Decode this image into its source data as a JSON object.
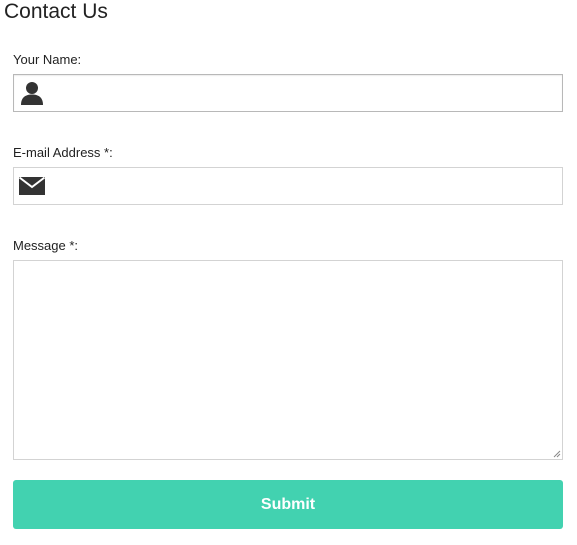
{
  "page": {
    "title": "Contact Us"
  },
  "form": {
    "name": {
      "label": "Your Name:",
      "value": "",
      "placeholder": "",
      "icon": "user-icon"
    },
    "email": {
      "label": "E-mail Address *:",
      "value": "",
      "placeholder": "",
      "icon": "envelope-icon"
    },
    "message": {
      "label": "Message *:",
      "value": "",
      "placeholder": ""
    },
    "submit_label": "Submit"
  },
  "colors": {
    "submit_background": "#42d2b0",
    "submit_text": "#ffffff",
    "icon": "#333333",
    "border": "#d3d3d3"
  }
}
